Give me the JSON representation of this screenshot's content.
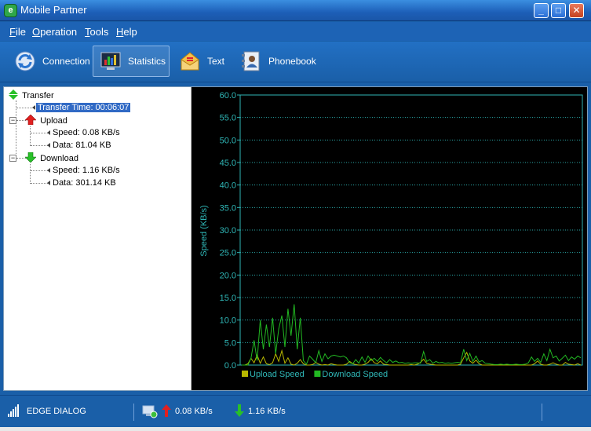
{
  "window": {
    "title": "Mobile Partner",
    "buttons": [
      "minimize",
      "maximize",
      "close"
    ]
  },
  "menu": [
    {
      "label": "File",
      "mnemonic": "F",
      "rest": "ile"
    },
    {
      "label": "Operation",
      "mnemonic": "O",
      "rest": "peration"
    },
    {
      "label": "Tools",
      "mnemonic": "T",
      "rest": "ools"
    },
    {
      "label": "Help",
      "mnemonic": "H",
      "rest": "elp"
    }
  ],
  "toolbar": [
    {
      "label": "Connection",
      "icon": "connection-icon",
      "active": false
    },
    {
      "label": "Statistics",
      "icon": "statistics-icon",
      "active": true
    },
    {
      "label": "Text",
      "icon": "text-message-icon",
      "active": false
    },
    {
      "label": "Phonebook",
      "icon": "phonebook-icon",
      "active": false
    }
  ],
  "tree": {
    "root": "Transfer",
    "transfer_time": "Transfer Time: 00:06:07",
    "upload": {
      "label": "Upload",
      "speed": "Speed: 0.08 KB/s",
      "data": "Data: 81.04 KB"
    },
    "download": {
      "label": "Download",
      "speed": "Speed: 1.16 KB/s",
      "data": "Data: 301.14 KB"
    }
  },
  "chart_data": {
    "type": "line",
    "ylabel": "Speed (KB/s)",
    "xlabel": "",
    "ylim": [
      0,
      60
    ],
    "yticks": [
      "0.0",
      "5.0",
      "10.0",
      "15.0",
      "20.0",
      "25.0",
      "30.0",
      "35.0",
      "40.0",
      "45.0",
      "50.0",
      "55.0",
      "60.0"
    ],
    "grid": true,
    "legend_position": "bottom",
    "series": [
      {
        "name": "Upload Speed",
        "color": "#b8b800",
        "values": [
          0,
          0,
          0.3,
          1.5,
          0.5,
          2.2,
          0.4,
          1.8,
          0.3,
          0.1,
          0.5,
          2.5,
          0.8,
          3.2,
          0.4,
          1.6,
          0.2,
          0,
          0.4,
          1.2,
          0.3,
          0,
          0,
          0.1,
          0.6,
          0.2,
          0,
          0.1,
          0,
          0.3,
          0.1,
          0,
          0,
          0,
          0.2,
          0.8,
          0.3,
          0.1,
          0,
          0,
          0.2,
          0.6,
          1.4,
          0.5,
          0.3,
          0.9,
          0.2,
          0.1,
          0,
          0,
          0,
          0,
          0,
          0,
          0,
          0.1,
          0,
          0.2,
          0.6,
          1.3,
          0.4,
          0.2,
          0.1,
          0,
          0,
          0,
          0,
          0,
          0,
          0,
          0,
          0.2,
          1.6,
          2.8,
          0.9,
          0.4,
          1.1,
          0.3,
          0,
          0,
          0,
          0,
          0,
          0,
          0,
          0,
          0,
          0,
          0,
          0,
          0,
          0,
          0,
          0,
          0,
          0.3,
          0.9,
          0.2,
          0,
          0,
          0.2,
          0.5,
          0.2,
          0,
          0,
          0.6,
          0.2,
          0.1,
          0,
          0.3,
          0
        ]
      },
      {
        "name": "Download Speed",
        "color": "#22b822",
        "values": [
          0,
          0,
          0,
          1.5,
          5.5,
          1.0,
          10.0,
          3.5,
          9.0,
          4.0,
          10.5,
          2.5,
          8.0,
          11.0,
          4.0,
          12.5,
          6.5,
          13.5,
          3.5,
          10.5,
          1.0,
          0.2,
          2.0,
          1.3,
          0.5,
          3.2,
          0.8,
          2.5,
          1.4,
          2.0,
          2.2,
          2.0,
          1.8,
          2.0,
          1.6,
          0.5,
          0.3,
          1.2,
          0.4,
          1.8,
          0.6,
          2.0,
          1.0,
          1.5,
          0.8,
          1.7,
          1.0,
          0.5,
          1.2,
          0.6,
          0.9,
          0.5,
          0.6,
          0.4,
          0.5,
          0.4,
          0.5,
          0.5,
          0.4,
          3.0,
          0.8,
          1.2,
          0.4,
          0.8,
          0.5,
          0.6,
          0.4,
          0.5,
          0.4,
          0.5,
          0.6,
          0.5,
          3.5,
          1.0,
          2.6,
          0.8,
          2.0,
          0.7,
          1.0,
          0.4,
          0.3,
          0.2,
          0.1,
          0.1,
          0.2,
          0.1,
          0.2,
          0.1,
          0.1,
          0.2,
          0.1,
          0.1,
          0.2,
          0.5,
          1.8,
          0.8,
          1.5,
          0.6,
          2.5,
          1.0,
          3.5,
          1.6,
          2.0,
          0.9,
          1.5,
          2.2,
          1.0,
          1.8,
          1.3,
          2.0,
          1.6
        ]
      }
    ]
  },
  "statusbar": {
    "network": "EDGE DIALOG",
    "upload_speed": "0.08 KB/s",
    "download_speed": "1.16 KB/s"
  },
  "colors": {
    "chrome": "#1a5fa8",
    "chart_axis": "#2fb6b6",
    "chart_grid": "#2aa6a6",
    "upload_arrow": "#e02020",
    "download_arrow": "#28c028"
  }
}
